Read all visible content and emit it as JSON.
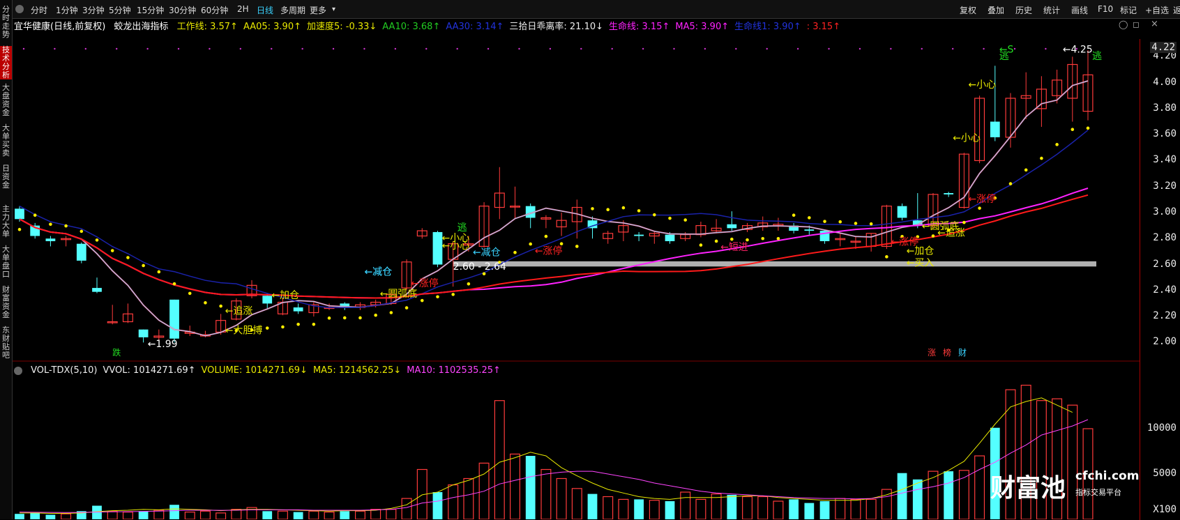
{
  "sidebar": {
    "items": [
      {
        "label": "分时走势",
        "active": false
      },
      {
        "label": "技术分析",
        "active": true
      },
      {
        "label": "大盘资金",
        "active": false
      },
      {
        "label": "大单买卖",
        "active": false
      },
      {
        "label": "日资金",
        "active": false
      },
      {
        "label": "主力大单",
        "active": false
      },
      {
        "label": "大单盘口",
        "active": false
      },
      {
        "label": "财富资金",
        "active": false
      },
      {
        "label": "东财贴吧",
        "active": false
      }
    ]
  },
  "toolbar": {
    "left": [
      "分时",
      "1分钟",
      "3分钟",
      "5分钟",
      "15分钟",
      "30分钟",
      "60分钟",
      "2H",
      "日线",
      "多周期",
      "更多"
    ],
    "active": "日线",
    "right": [
      "复权",
      "叠加",
      "历史",
      "统计",
      "画线",
      "F10",
      "标记",
      "+自选",
      "返回"
    ]
  },
  "main_info": {
    "stock": "宜华健康(日线,前复权)",
    "indicator": "蛟龙出海指标",
    "items": [
      {
        "text": "工作线: 3.57↑",
        "color": "#e8e800"
      },
      {
        "text": "AA05: 3.90↑",
        "color": "#e8e800"
      },
      {
        "text": "加速度5: -0.33↓",
        "color": "#e8e800"
      },
      {
        "text": "AA10: 3.68↑",
        "color": "#22cc22"
      },
      {
        "text": "AA30: 3.14↑",
        "color": "#2233dd"
      },
      {
        "text": "三拾日乖离率: 21.10↓",
        "color": "#eeeeee"
      },
      {
        "text": "生命线: 3.15↑",
        "color": "#ff22ff"
      },
      {
        "text": "MA5: 3.90↑",
        "color": "#ff22ff"
      },
      {
        "text": "生命线1: 3.90↑",
        "color": "#2233dd"
      },
      {
        "text": ": 3.15↑",
        "color": "#ff2222"
      }
    ]
  },
  "vol_info": {
    "items": [
      {
        "text": "VOL-TDX(5,10)",
        "color": "#eeeeee"
      },
      {
        "text": "VVOL: 1014271.69↑",
        "color": "#eeeeee"
      },
      {
        "text": "VOLUME: 1014271.69↓",
        "color": "#e8e800"
      },
      {
        "text": "MA5: 1214562.25↓",
        "color": "#e8e800"
      },
      {
        "text": "MA10: 1102535.25↑",
        "color": "#ff44ff"
      }
    ]
  },
  "price_axis": {
    "ticks": [
      "4.20",
      "4.00",
      "3.80",
      "3.60",
      "3.40",
      "3.20",
      "3.00",
      "2.80",
      "2.60",
      "2.40",
      "2.20",
      "2.00"
    ],
    "current": "4.22"
  },
  "vol_axis": {
    "ticks": [
      "10000",
      "5000"
    ],
    "unit": "X100"
  },
  "annotations": {
    "low_price": "1.99",
    "high_price": "4.25",
    "gap_range": "2.60 - 2.64",
    "bottom_tags": [
      "跌",
      "涨",
      "榜",
      "财"
    ]
  },
  "signals": [
    {
      "text": "←减仓",
      "color": "#3ad3ff"
    },
    {
      "text": "←加仓",
      "color": "#e8e800"
    },
    {
      "text": "←追涨",
      "color": "#e8e800"
    },
    {
      "text": "←大胆搏",
      "color": "#e8e800"
    },
    {
      "text": "←圆弧底",
      "color": "#e8e800"
    },
    {
      "text": "←涨停",
      "color": "#ff2222"
    },
    {
      "text": "←小心",
      "color": "#e8e800"
    },
    {
      "text": "逃",
      "color": "#22dd22"
    },
    {
      "text": "←短进",
      "color": "#ff2266"
    },
    {
      "text": "←买入",
      "color": "#e8e800"
    },
    {
      "text": "←S",
      "color": "#22dd22"
    }
  ],
  "watermark": {
    "brand": "财富池",
    "site": "cfchi.com",
    "slogan": "指标交易平台"
  },
  "chart_data": {
    "type": "candlestick",
    "price_range": [
      1.9,
      4.25
    ],
    "candles": [
      {
        "o": 3.03,
        "c": 2.95,
        "h": 3.05,
        "l": 2.93
      },
      {
        "o": 2.9,
        "c": 2.82,
        "h": 2.92,
        "l": 2.8
      },
      {
        "o": 2.8,
        "c": 2.78,
        "h": 2.82,
        "l": 2.74
      },
      {
        "o": 2.8,
        "c": 2.8,
        "h": 2.82,
        "l": 2.74
      },
      {
        "o": 2.76,
        "c": 2.63,
        "h": 2.77,
        "l": 2.61
      },
      {
        "o": 2.42,
        "c": 2.39,
        "h": 2.5,
        "l": 2.38
      },
      {
        "o": 2.16,
        "c": 2.16,
        "h": 2.29,
        "l": 2.14
      },
      {
        "o": 2.16,
        "c": 2.22,
        "h": 2.3,
        "l": 2.15
      },
      {
        "o": 2.1,
        "c": 2.04,
        "h": 2.1,
        "l": 2.0
      },
      {
        "o": 2.04,
        "c": 2.05,
        "h": 2.1,
        "l": 2.02
      },
      {
        "o": 2.33,
        "c": 2.03,
        "h": 2.33,
        "l": 2.0
      },
      {
        "o": 2.07,
        "c": 2.08,
        "h": 2.13,
        "l": 2.05
      },
      {
        "o": 2.05,
        "c": 2.06,
        "h": 2.09,
        "l": 2.04
      },
      {
        "o": 2.08,
        "c": 2.17,
        "h": 2.22,
        "l": 2.06
      },
      {
        "o": 2.18,
        "c": 2.32,
        "h": 2.34,
        "l": 2.17
      },
      {
        "o": 2.36,
        "c": 2.44,
        "h": 2.48,
        "l": 2.34
      },
      {
        "o": 2.36,
        "c": 2.3,
        "h": 2.38,
        "l": 2.26
      },
      {
        "o": 2.22,
        "c": 2.31,
        "h": 2.35,
        "l": 2.21
      },
      {
        "o": 2.27,
        "c": 2.24,
        "h": 2.3,
        "l": 2.22
      },
      {
        "o": 2.23,
        "c": 2.29,
        "h": 2.31,
        "l": 2.2
      },
      {
        "o": 2.27,
        "c": 2.27,
        "h": 2.3,
        "l": 2.25
      },
      {
        "o": 2.3,
        "c": 2.27,
        "h": 2.31,
        "l": 2.25
      },
      {
        "o": 2.27,
        "c": 2.29,
        "h": 2.31,
        "l": 2.25
      },
      {
        "o": 2.29,
        "c": 2.31,
        "h": 2.33,
        "l": 2.27
      },
      {
        "o": 2.3,
        "c": 2.37,
        "h": 2.4,
        "l": 2.29
      },
      {
        "o": 2.42,
        "c": 2.62,
        "h": 2.64,
        "l": 2.4
      },
      {
        "o": 2.82,
        "c": 2.86,
        "h": 2.88,
        "l": 2.8
      },
      {
        "o": 2.85,
        "c": 2.6,
        "h": 2.86,
        "l": 2.58
      },
      {
        "o": 2.64,
        "c": 2.76,
        "h": 2.78,
        "l": 2.43
      },
      {
        "o": 2.75,
        "c": 2.76,
        "h": 2.82,
        "l": 2.7
      },
      {
        "o": 2.74,
        "c": 3.05,
        "h": 3.08,
        "l": 2.73
      },
      {
        "o": 3.04,
        "c": 3.15,
        "h": 3.35,
        "l": 2.95
      },
      {
        "o": 3.05,
        "c": 3.05,
        "h": 3.2,
        "l": 2.95
      },
      {
        "o": 3.05,
        "c": 2.96,
        "h": 3.07,
        "l": 2.88
      },
      {
        "o": 2.95,
        "c": 2.96,
        "h": 2.98,
        "l": 2.88
      },
      {
        "o": 2.89,
        "c": 2.94,
        "h": 3.0,
        "l": 2.82
      },
      {
        "o": 2.93,
        "c": 3.04,
        "h": 3.1,
        "l": 2.8
      },
      {
        "o": 2.94,
        "c": 2.88,
        "h": 2.97,
        "l": 2.8
      },
      {
        "o": 2.8,
        "c": 2.84,
        "h": 2.86,
        "l": 2.76
      },
      {
        "o": 2.85,
        "c": 2.9,
        "h": 2.94,
        "l": 2.78
      },
      {
        "o": 2.83,
        "c": 2.82,
        "h": 2.85,
        "l": 2.78
      },
      {
        "o": 2.82,
        "c": 2.84,
        "h": 2.86,
        "l": 2.76
      },
      {
        "o": 2.83,
        "c": 2.78,
        "h": 2.85,
        "l": 2.76
      },
      {
        "o": 2.8,
        "c": 2.83,
        "h": 2.85,
        "l": 2.78
      },
      {
        "o": 2.83,
        "c": 2.9,
        "h": 2.93,
        "l": 2.81
      },
      {
        "o": 2.86,
        "c": 2.88,
        "h": 2.95,
        "l": 2.84
      },
      {
        "o": 2.91,
        "c": 2.88,
        "h": 3.01,
        "l": 2.86
      },
      {
        "o": 2.87,
        "c": 2.9,
        "h": 2.92,
        "l": 2.85
      },
      {
        "o": 2.89,
        "c": 2.92,
        "h": 2.97,
        "l": 2.86
      },
      {
        "o": 2.9,
        "c": 2.91,
        "h": 2.96,
        "l": 2.86
      },
      {
        "o": 2.9,
        "c": 2.86,
        "h": 2.92,
        "l": 2.84
      },
      {
        "o": 2.87,
        "c": 2.86,
        "h": 2.9,
        "l": 2.83
      },
      {
        "o": 2.86,
        "c": 2.78,
        "h": 2.87,
        "l": 2.76
      },
      {
        "o": 2.8,
        "c": 2.8,
        "h": 2.84,
        "l": 2.74
      },
      {
        "o": 2.78,
        "c": 2.78,
        "h": 2.82,
        "l": 2.72
      },
      {
        "o": 2.74,
        "c": 2.84,
        "h": 2.84,
        "l": 2.7
      },
      {
        "o": 2.74,
        "c": 3.05,
        "h": 3.06,
        "l": 2.72
      },
      {
        "o": 3.05,
        "c": 2.96,
        "h": 3.07,
        "l": 2.94
      },
      {
        "o": 2.94,
        "c": 2.9,
        "h": 3.15,
        "l": 2.88
      },
      {
        "o": 2.9,
        "c": 3.14,
        "h": 3.15,
        "l": 2.88
      },
      {
        "o": 3.15,
        "c": 3.14,
        "h": 3.16,
        "l": 3.12
      },
      {
        "o": 3.04,
        "c": 3.45,
        "h": 3.46,
        "l": 3.03
      },
      {
        "o": 3.4,
        "c": 3.88,
        "h": 3.9,
        "l": 3.38
      },
      {
        "o": 3.7,
        "c": 3.58,
        "h": 4.13,
        "l": 3.55
      },
      {
        "o": 3.58,
        "c": 3.88,
        "h": 3.92,
        "l": 3.5
      },
      {
        "o": 3.88,
        "c": 3.9,
        "h": 4.08,
        "l": 3.72
      },
      {
        "o": 3.8,
        "c": 3.95,
        "h": 4.05,
        "l": 3.66
      },
      {
        "o": 3.9,
        "c": 4.02,
        "h": 4.1,
        "l": 3.84
      },
      {
        "o": 3.88,
        "c": 4.14,
        "h": 4.2,
        "l": 3.7
      },
      {
        "o": 3.78,
        "c": 4.06,
        "h": 4.25,
        "l": 3.71
      }
    ],
    "volume": [
      600,
      700,
      500,
      600,
      900,
      1500,
      900,
      800,
      900,
      1000,
      1600,
      800,
      900,
      700,
      1100,
      1300,
      900,
      900,
      800,
      900,
      800,
      900,
      900,
      1100,
      1100,
      2300,
      5500,
      3000,
      3800,
      4500,
      6200,
      13100,
      7200,
      7000,
      5500,
      4500,
      3400,
      2800,
      2500,
      2200,
      2200,
      2100,
      2000,
      3000,
      2200,
      2800,
      2700,
      2500,
      2500,
      2000,
      2200,
      1800,
      2000,
      2300,
      2200,
      2200,
      3300,
      5100,
      4400,
      5300,
      5300,
      5400,
      7000,
      10100,
      14300,
      14800,
      13100,
      13300,
      12600,
      10000
    ],
    "ma5": [
      700,
      700,
      650,
      650,
      700,
      850,
      950,
      1000,
      1100,
      1050,
      1150,
      1100,
      1050,
      950,
      1050,
      1100,
      1100,
      1050,
      1000,
      950,
      900,
      950,
      950,
      1000,
      1200,
      1600,
      2700,
      3000,
      3800,
      4300,
      5000,
      6300,
      6800,
      7400,
      7000,
      5700,
      4800,
      4000,
      3300,
      2900,
      2500,
      2300,
      2200,
      2400,
      2400,
      2400,
      2500,
      2600,
      2600,
      2400,
      2300,
      2200,
      2100,
      2100,
      2100,
      2300,
      2700,
      3300,
      4000,
      4600,
      5400,
      6400,
      8400,
      10500,
      12400,
      13000,
      13400,
      12600,
      11800
    ],
    "ma10": [
      800,
      780,
      760,
      750,
      760,
      800,
      830,
      850,
      880,
      900,
      950,
      1000,
      1000,
      990,
      1000,
      1050,
      1050,
      1050,
      1050,
      1000,
      1000,
      1000,
      1000,
      1050,
      1100,
      1300,
      1800,
      2000,
      2400,
      2700,
      3100,
      3900,
      4300,
      4700,
      5000,
      5200,
      5300,
      5300,
      5000,
      4700,
      4400,
      4000,
      3700,
      3400,
      3100,
      2900,
      2800,
      2700,
      2600,
      2500,
      2400,
      2350,
      2300,
      2300,
      2250,
      2300,
      2500,
      2900,
      3300,
      3600,
      4000,
      4600,
      5500,
      6300,
      7300,
      8200,
      9300,
      9800,
      10300,
      11000
    ]
  }
}
